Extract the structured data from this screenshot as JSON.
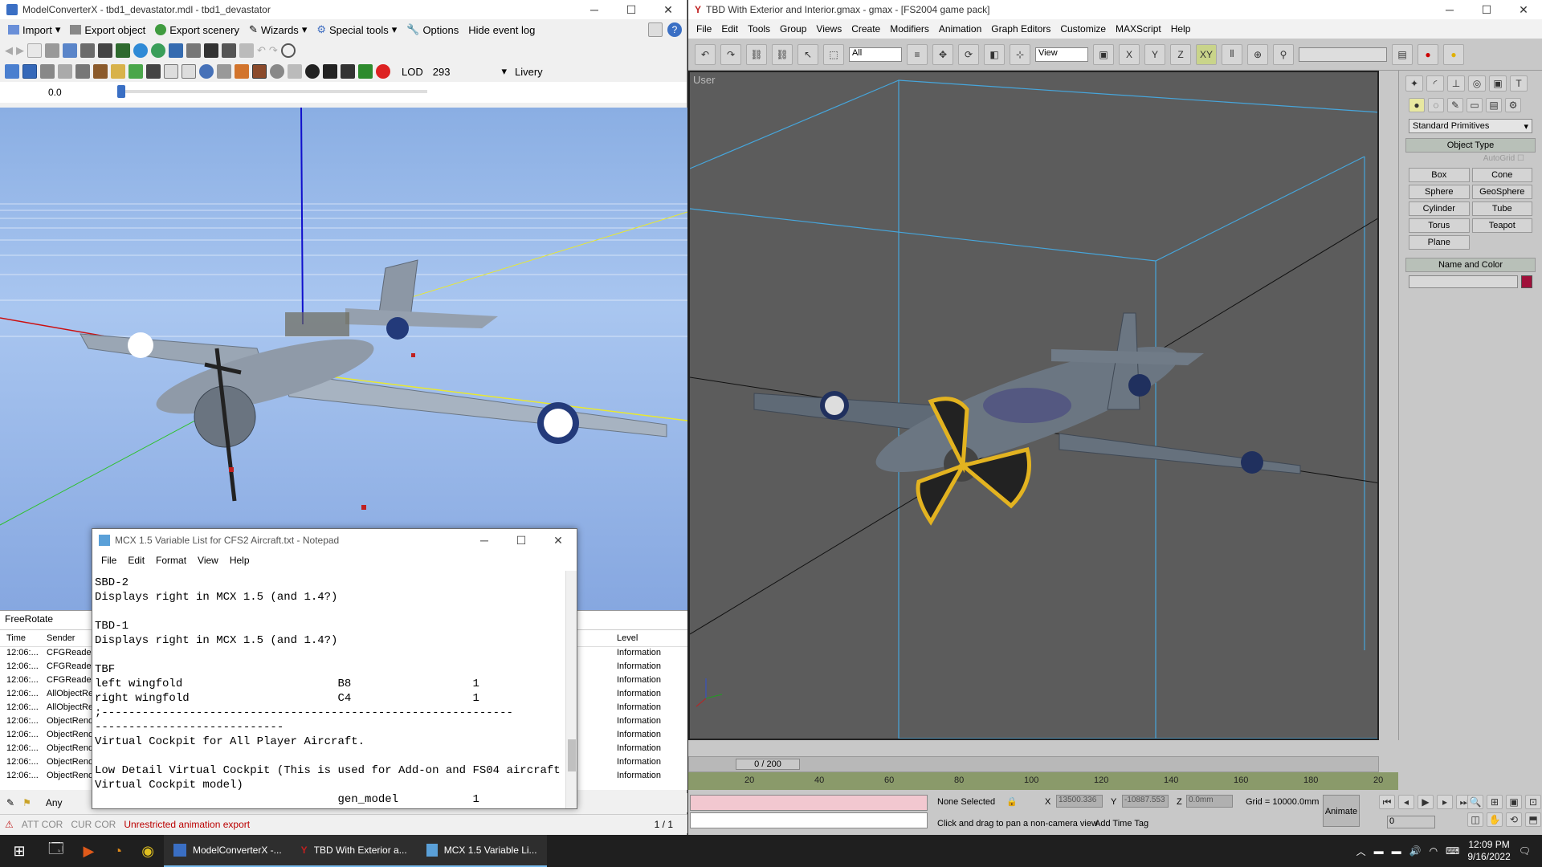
{
  "mcx": {
    "title": "ModelConverterX - tbd1_devastator.mdl - tbd1_devastator",
    "menu": [
      "Import",
      "Export object",
      "Export scenery",
      "Wizards",
      "Special tools",
      "Options",
      "Hide event log"
    ],
    "lod_label": "LOD",
    "lod_value": "293",
    "livery_label": "Livery",
    "slider_value": "0.0",
    "camera_mode": "FreeRotate",
    "log_headers": [
      "Time",
      "Sender",
      "Level"
    ],
    "log_rows": [
      {
        "time": "12:06:...",
        "sender": "CFGReader",
        "level": "Information"
      },
      {
        "time": "12:06:...",
        "sender": "CFGReader",
        "level": "Information"
      },
      {
        "time": "12:06:...",
        "sender": "CFGReader",
        "level": "Information"
      },
      {
        "time": "12:06:...",
        "sender": "AllObjectRe",
        "level": "Information"
      },
      {
        "time": "12:06:...",
        "sender": "AllObjectRe",
        "level": "Information"
      },
      {
        "time": "12:06:...",
        "sender": "ObjectRend",
        "level": "Information"
      },
      {
        "time": "12:06:...",
        "sender": "ObjectRend",
        "level": "Information"
      },
      {
        "time": "12:06:...",
        "sender": "ObjectRend",
        "level": "Information"
      },
      {
        "time": "12:06:...",
        "sender": "ObjectRend",
        "level": "Information"
      },
      {
        "time": "12:06:...",
        "sender": "ObjectRend",
        "level": "Information"
      }
    ],
    "filter_value": "Any",
    "status_attcor": "ATT COR",
    "status_curcor": "CUR COR",
    "status_message": "Unrestricted animation export",
    "page_count": "1 / 1"
  },
  "notepad": {
    "title": "MCX 1.5 Variable List for CFS2 Aircraft.txt - Notepad",
    "menu": [
      "File",
      "Edit",
      "Format",
      "View",
      "Help"
    ],
    "lines": [
      "SBD-2",
      "Displays right in MCX 1.5 (and 1.4?)",
      "",
      "TBD-1",
      "Displays right in MCX 1.5 (and 1.4?)",
      "",
      "TBF",
      "left wingfold                       B8                  1",
      "right wingfold                      C4                  1",
      ";-------------------------------------------------------------",
      "----------------------------",
      "Virtual Cockpit for All Player Aircraft.",
      "",
      "Low Detail Virtual Cockpit (This is used for Add-on and FS04 aircraft",
      "Virtual Cockpit model)",
      "                                    gen_model           1"
    ]
  },
  "gmax": {
    "title": "TBD With Exterior and Interior.gmax - gmax - [FS2004 game pack]",
    "menu": [
      "File",
      "Edit",
      "Tools",
      "Group",
      "Views",
      "Create",
      "Modifiers",
      "Animation",
      "Graph Editors",
      "Customize",
      "MAXScript",
      "Help"
    ],
    "selection_filter": "All",
    "ref_coord": "View",
    "viewport_label": "User",
    "category_dropdown": "Standard Primitives",
    "object_type_header": "Object Type",
    "autogrid_label": "AutoGrid",
    "primitives": [
      "Box",
      "Cone",
      "Sphere",
      "GeoSphere",
      "Cylinder",
      "Tube",
      "Torus",
      "Teapot",
      "Plane"
    ],
    "name_color_header": "Name and Color",
    "time_slider": "0 / 200",
    "ticks": [
      "20",
      "40",
      "60",
      "80",
      "100",
      "120",
      "140",
      "160",
      "180",
      "20"
    ],
    "selection_status": "None Selected",
    "x_label": "X",
    "x_value": "13500.336",
    "y_label": "Y",
    "y_value": "-10887.553",
    "z_label": "Z",
    "z_value": "0.0mm",
    "grid_value": "Grid = 10000.0mm",
    "animate_label": "Animate",
    "prompt_text": "Click and drag to pan a non-camera view",
    "add_time_tag": "Add Time Tag",
    "frame_value": "0"
  },
  "taskbar": {
    "items": [
      "ModelConverterX -...",
      "TBD With Exterior a...",
      "MCX 1.5 Variable Li..."
    ],
    "time": "12:09 PM",
    "date": "9/16/2022"
  }
}
